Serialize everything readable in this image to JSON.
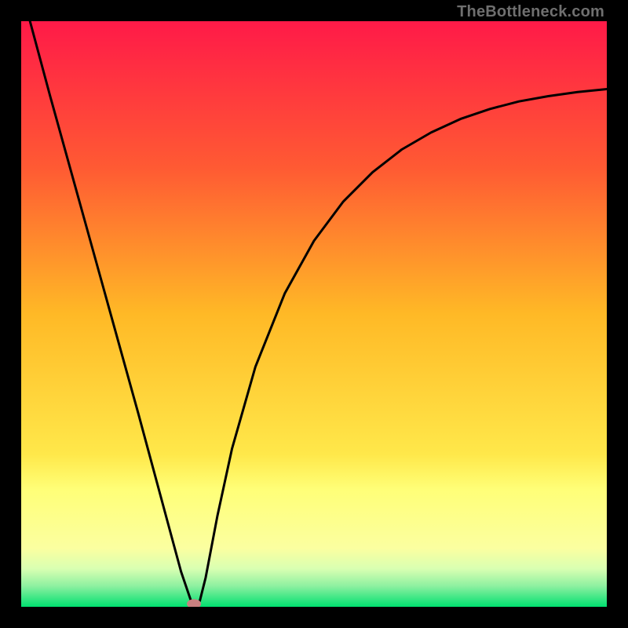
{
  "watermark": "TheBottleneck.com",
  "chart_data": {
    "type": "line",
    "title": "",
    "xlabel": "",
    "ylabel": "",
    "xlim": [
      0,
      1
    ],
    "ylim": [
      0,
      1
    ],
    "axes_visible": false,
    "legend": false,
    "background_gradient_stops": [
      {
        "offset": 0.0,
        "color": "#ff1a48"
      },
      {
        "offset": 0.25,
        "color": "#ff5a33"
      },
      {
        "offset": 0.5,
        "color": "#ffb926"
      },
      {
        "offset": 0.74,
        "color": "#ffe84a"
      },
      {
        "offset": 0.8,
        "color": "#ffff78"
      },
      {
        "offset": 0.9,
        "color": "#fbffa0"
      },
      {
        "offset": 0.935,
        "color": "#d9ffb2"
      },
      {
        "offset": 0.965,
        "color": "#8cf0a0"
      },
      {
        "offset": 1.0,
        "color": "#00e070"
      }
    ],
    "series": [
      {
        "name": "bottleneck-curve",
        "type": "line",
        "color": "#000000",
        "width": 3,
        "x": [
          0.015,
          0.05,
          0.1,
          0.15,
          0.2,
          0.25,
          0.273,
          0.29,
          0.295,
          0.305,
          0.315,
          0.335,
          0.36,
          0.4,
          0.45,
          0.5,
          0.55,
          0.6,
          0.65,
          0.7,
          0.75,
          0.8,
          0.85,
          0.9,
          0.95,
          1.0
        ],
        "y": [
          1.0,
          0.87,
          0.69,
          0.51,
          0.33,
          0.145,
          0.06,
          0.01,
          0.0,
          0.01,
          0.05,
          0.155,
          0.27,
          0.41,
          0.535,
          0.625,
          0.692,
          0.742,
          0.781,
          0.81,
          0.833,
          0.85,
          0.863,
          0.872,
          0.879,
          0.884
        ]
      },
      {
        "name": "optimum-marker",
        "type": "scatter",
        "color": "#c98080",
        "x": [
          0.295
        ],
        "y": [
          0.005
        ],
        "marker_rx": 9,
        "marker_ry": 6
      }
    ]
  }
}
